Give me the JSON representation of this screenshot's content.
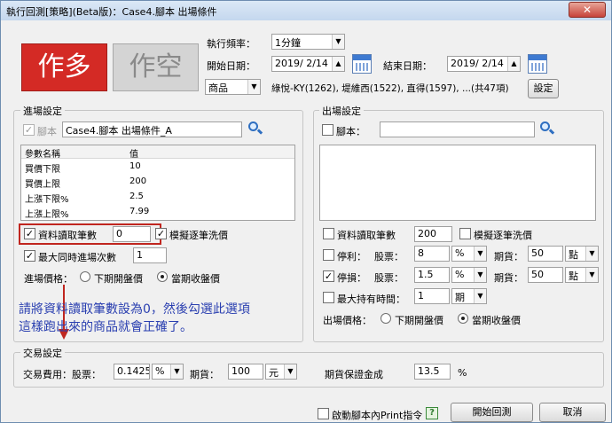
{
  "window": {
    "title": "執行回測[策略](Beta版)：Case4.腳本 出場條件",
    "close_glyph": "✕"
  },
  "top": {
    "long_label": "作多",
    "short_label": "作空",
    "freq_label": "執行頻率：",
    "freq_value": "1分鐘",
    "start_label": "開始日期：",
    "start_value": "2019/ 2/14",
    "end_label": "結束日期：",
    "end_value": "2019/ 2/14",
    "product_type": "商品",
    "product_list": "綠悅-KY(1262), 堤維西(1522), 直得(1597), ...(共47項)",
    "settings_button": "設定"
  },
  "entry": {
    "title": "進場設定",
    "script_label": "腳本",
    "script_value": "Case4.腳本 出場條件_A",
    "table": {
      "headers": [
        "參數名稱",
        "值"
      ],
      "rows": [
        {
          "name": "買價下限",
          "value": "10"
        },
        {
          "name": "買價上限",
          "value": "200"
        },
        {
          "name": "上漲下限%",
          "value": "2.5"
        },
        {
          "name": "上漲上限%",
          "value": "7.99"
        }
      ]
    },
    "bars_label": "資料讀取筆數",
    "bars_value": "0",
    "simulate_label": "模擬逐筆洗價",
    "max_entries_label": "最大同時進場次數",
    "max_entries_value": "1",
    "price_label": "進場價格：",
    "price_next_open": "下期開盤價",
    "price_close": "當期收盤價"
  },
  "exit": {
    "title": "出場設定",
    "script_label": "腳本：",
    "script_value": "",
    "bars_label": "資料讀取筆數",
    "bars_value": "200",
    "simulate_label": "模擬逐筆洗價",
    "stop_profit_label": "停利：",
    "stop_loss_label": "停損：",
    "stock_label": "股票：",
    "futures_label": "期貨：",
    "profit_stock": "8",
    "profit_unit": "%",
    "profit_fut": "50",
    "profit_fut_unit": "點",
    "loss_stock": "1.5",
    "loss_unit": "%",
    "loss_fut": "50",
    "loss_fut_unit": "點",
    "max_hold_label": "最大持有時間：",
    "max_hold_value": "1",
    "max_hold_unit": "期",
    "price_label": "出場價格：",
    "price_next_open": "下期開盤價",
    "price_close": "當期收盤價"
  },
  "annotation": {
    "line1": "請將資料讀取筆數設為0，然後勾選此選項",
    "line2": "這樣跑出來的商品就會正確了。"
  },
  "trade": {
    "title": "交易設定",
    "fee_label": "交易費用：股票：",
    "fee_stock": "0.1425",
    "fee_stock_unit": "%",
    "fee_fut_label": "期貨：",
    "fee_fut": "100",
    "fee_fut_unit": "元",
    "margin_label": "期貨保證金成",
    "margin_value": "13.5",
    "margin_unit": "%"
  },
  "bottom": {
    "print_label": "啟動腳本內Print指令",
    "help_glyph": "?",
    "start_button": "開始回測",
    "cancel_button": "取消"
  },
  "colors": {
    "long": "#d42a25",
    "short": "#d4d4d4",
    "annotation": "#2a3fb0",
    "highlight": "#c0261f"
  }
}
